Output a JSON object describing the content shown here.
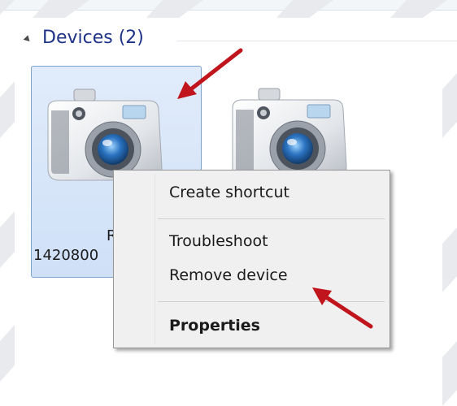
{
  "group": {
    "title": "Devices (2)"
  },
  "devices": [
    {
      "name": "RS",
      "serial": "1420800"
    },
    {
      "name": "",
      "serial": ""
    }
  ],
  "context_menu": {
    "items": [
      {
        "label": "Create shortcut"
      },
      {
        "label": "Troubleshoot"
      },
      {
        "label": "Remove device"
      },
      {
        "label": "Properties"
      }
    ]
  },
  "colors": {
    "group_title": "#1e3287",
    "selection": "#cfe0f7",
    "arrow": "#c0151c"
  },
  "icons": {
    "device": "camera-icon",
    "expand": "collapse-triangle-icon",
    "annotation": "red-arrow-icon"
  }
}
